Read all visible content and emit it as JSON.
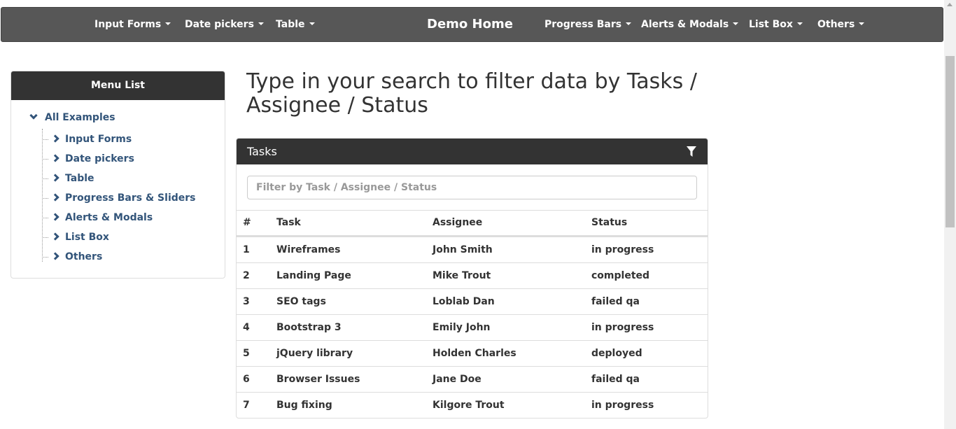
{
  "navbar": {
    "left_items": [
      "Input Forms",
      "Date pickers",
      "Table"
    ],
    "brand": "Demo Home",
    "right_items": [
      "Progress Bars",
      "Alerts & Modals",
      "List Box",
      "Others"
    ]
  },
  "sidebar": {
    "title": "Menu List",
    "root": "All Examples",
    "items": [
      "Input Forms",
      "Date pickers",
      "Table",
      "Progress Bars & Sliders",
      "Alerts & Modals",
      "List Box",
      "Others"
    ]
  },
  "heading": "Type in your search to filter data by Tasks / Assignee / Status",
  "panel": {
    "title": "Tasks",
    "filter_icon": "filter-icon",
    "filter_placeholder": "Filter by Task / Assignee / Status",
    "filter_value": "",
    "columns": [
      "#",
      "Task",
      "Assignee",
      "Status"
    ],
    "rows": [
      [
        "1",
        "Wireframes",
        "John Smith",
        "in progress"
      ],
      [
        "2",
        "Landing Page",
        "Mike Trout",
        "completed"
      ],
      [
        "3",
        "SEO tags",
        "Loblab Dan",
        "failed qa"
      ],
      [
        "4",
        "Bootstrap 3",
        "Emily John",
        "in progress"
      ],
      [
        "5",
        "jQuery library",
        "Holden Charles",
        "deployed"
      ],
      [
        "6",
        "Browser Issues",
        "Jane Doe",
        "failed qa"
      ],
      [
        "7",
        "Bug fixing",
        "Kilgore Trout",
        "in progress"
      ]
    ]
  }
}
